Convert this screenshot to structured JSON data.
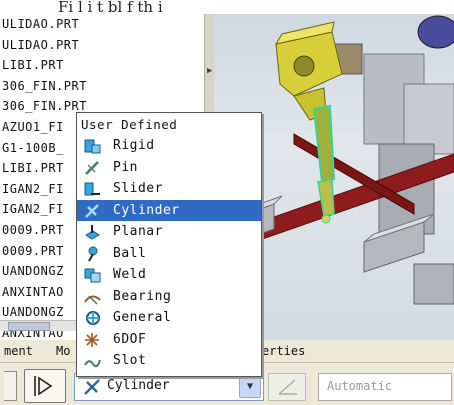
{
  "caption": "Fi   l      i t        bl   f th    i",
  "file_list": [
    "ULIDAO.PRT",
    "ULIDAO.PRT",
    "LIBI.PRT",
    "306_FIN.PRT",
    "306_FIN.PRT",
    "AZUO1_FI",
    "G1-100B_",
    "LIBI.PRT",
    "IGAN2_FI",
    "IGAN2_FI",
    "0009.PRT",
    "0009.PRT",
    "UANDONGZ",
    "ANXINTAO",
    "UANDONGZ",
    "ANXINTAO"
  ],
  "menu": {
    "header": "User Defined",
    "items": [
      {
        "label": "Rigid",
        "icon": "rigid-icon"
      },
      {
        "label": "Pin",
        "icon": "pin-icon"
      },
      {
        "label": "Slider",
        "icon": "slider-icon"
      },
      {
        "label": "Cylinder",
        "icon": "cylinder-icon",
        "selected": true
      },
      {
        "label": "Planar",
        "icon": "planar-icon"
      },
      {
        "label": "Ball",
        "icon": "ball-icon"
      },
      {
        "label": "Weld",
        "icon": "weld-icon"
      },
      {
        "label": "Bearing",
        "icon": "bearing-icon"
      },
      {
        "label": "General",
        "icon": "general-icon"
      },
      {
        "label": "6DOF",
        "icon": "6dof-icon"
      },
      {
        "label": "Slot",
        "icon": "slot-icon"
      }
    ]
  },
  "tabs": {
    "left": "ment",
    "mid": "Mo",
    "right": "erties"
  },
  "toolbar": {
    "combo_value": "Cylinder",
    "auto_value": "Automatic"
  },
  "colors": {
    "selection": "#316ac5",
    "part_yellow": "#d6cf3a",
    "frame_red": "#8e1c1c",
    "highlight_green": "#37d39a"
  }
}
